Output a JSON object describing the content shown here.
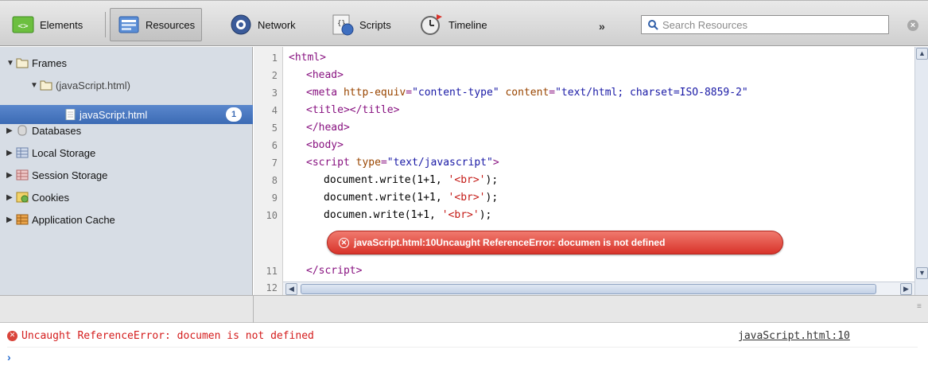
{
  "toolbar": {
    "elements": "Elements",
    "resources": "Resources",
    "network": "Network",
    "scripts": "Scripts",
    "timeline": "Timeline",
    "more": "»",
    "search_placeholder": "Search Resources"
  },
  "sidebar": {
    "frames": "Frames",
    "frame": "(javaScript.html)",
    "file": "javaScript.html",
    "badge": "1",
    "databases": "Databases",
    "local_storage": "Local Storage",
    "session_storage": "Session Storage",
    "cookies": "Cookies",
    "app_cache": "Application Cache"
  },
  "code": {
    "line_numbers": [
      "1",
      "2",
      "3",
      "4",
      "5",
      "6",
      "7",
      "8",
      "9",
      "10",
      "11",
      "12"
    ],
    "inline_error": "javaScript.html:10Uncaught ReferenceError: documen is not defined"
  },
  "console": {
    "error": "Uncaught ReferenceError: documen is not defined",
    "source": "javaScript.html:10",
    "prompt": "›"
  },
  "colors": {
    "selection": "#3c6bb5",
    "error_red": "#d41c1c",
    "sidebar_bg": "#d7dde5"
  }
}
